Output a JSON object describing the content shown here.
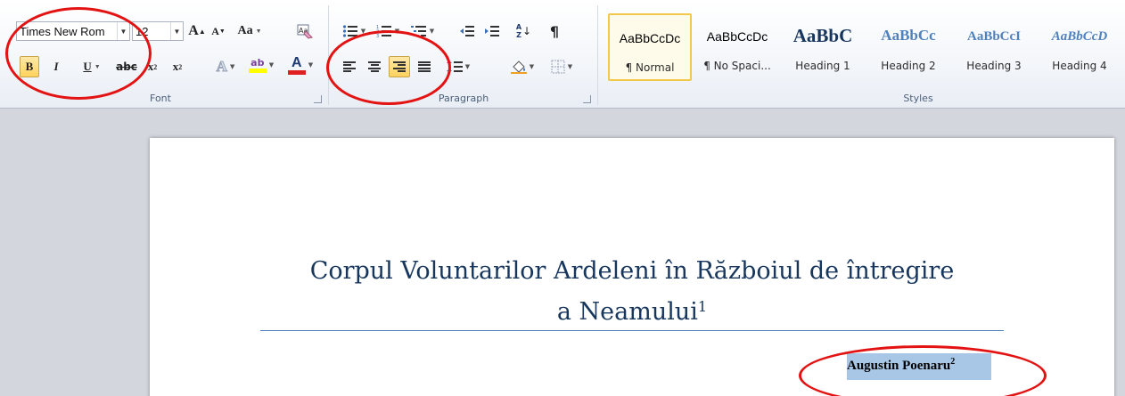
{
  "ribbon": {
    "font_group": {
      "label": "Font",
      "font_name": "Times New Rom",
      "font_size": "12",
      "grow_font": "A",
      "shrink_font": "A",
      "change_case": "Aa",
      "bold": "B",
      "italic": "I",
      "underline": "U",
      "strikethrough": "abc",
      "subscript": "x",
      "superscript": "x",
      "font_color": "A"
    },
    "paragraph_group": {
      "label": "Paragraph",
      "sort": "A Z",
      "show_marks": "¶",
      "active_alignment": "align-right"
    },
    "styles_group": {
      "label": "Styles",
      "styles": [
        {
          "sample": "AaBbCcDc",
          "name": "¶ Normal",
          "selected": true
        },
        {
          "sample": "AaBbCcDc",
          "name": "¶ No Spaci...",
          "selected": false
        },
        {
          "sample": "AaBbC",
          "name": "Heading 1",
          "selected": false
        },
        {
          "sample": "AaBbCc",
          "name": "Heading 2",
          "selected": false
        },
        {
          "sample": "AaBbCcI",
          "name": "Heading 3",
          "selected": false
        },
        {
          "sample": "AaBbCcD",
          "name": "Heading 4",
          "selected": false
        }
      ]
    }
  },
  "document": {
    "title_line1": "Corpul Voluntarilor  Ardeleni în Războiul de întregire",
    "title_line2": "a Neamului",
    "title_footnote": "1",
    "author": "Augustin Poenaru",
    "author_footnote": "2"
  },
  "colors": {
    "annotation": "#e41313",
    "selection": "#a8c7e6",
    "title": "#17365d",
    "title_rule": "#4f81bd",
    "active_button": "#ffd25e"
  },
  "icons": [
    "grow-font-icon",
    "shrink-font-icon",
    "change-case-icon",
    "clear-formatting-icon",
    "bold-icon",
    "italic-icon",
    "underline-icon",
    "strikethrough-icon",
    "subscript-icon",
    "superscript-icon",
    "text-effects-icon",
    "highlight-icon",
    "font-color-icon",
    "bullets-icon",
    "numbering-icon",
    "multilevel-list-icon",
    "decrease-indent-icon",
    "increase-indent-icon",
    "sort-icon",
    "show-marks-icon",
    "align-left-icon",
    "align-center-icon",
    "align-right-icon",
    "justify-icon",
    "line-spacing-icon",
    "shading-icon",
    "borders-icon"
  ]
}
